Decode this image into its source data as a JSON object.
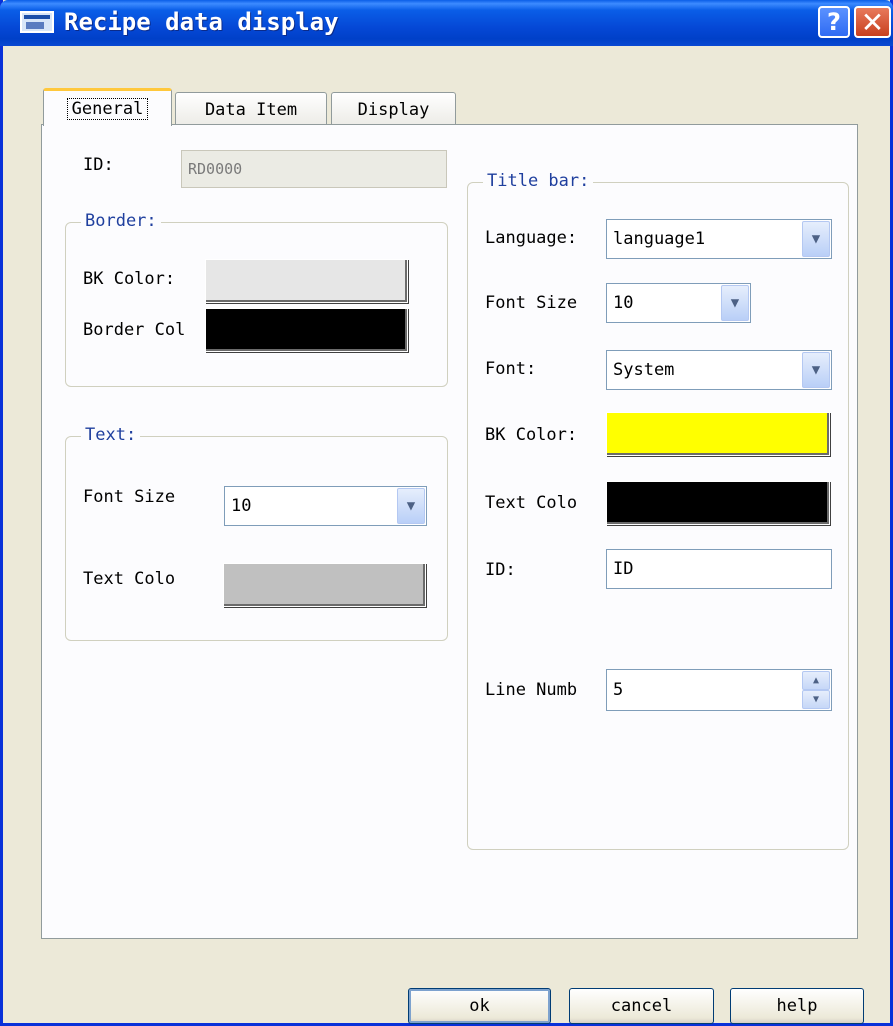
{
  "window": {
    "title": "Recipe data display"
  },
  "tabs": [
    "General",
    "Data Item",
    "Display"
  ],
  "general": {
    "id_label": "ID:",
    "id_value": "RD0000",
    "border": {
      "title": "Border:",
      "bk_color_label": "BK Color:",
      "bk_color": "#e6e6e6",
      "border_color_label": "Border Col",
      "border_color": "#000000"
    },
    "text": {
      "title": "Text:",
      "font_size_label": "Font Size",
      "font_size_value": "10",
      "text_color_label": "Text Colo",
      "text_color": "#c0c0c0"
    },
    "title_bar": {
      "title": "Title bar:",
      "language_label": "Language:",
      "language_value": "language1",
      "font_size_label": "Font Size",
      "font_size_value": "10",
      "font_label": "Font:",
      "font_value": "System",
      "bk_color_label": "BK Color:",
      "bk_color": "#ffff00",
      "text_color_label": "Text Colo",
      "text_color": "#000000",
      "id_label": "ID:",
      "id_value": "ID",
      "line_num_label": "Line Numb",
      "line_num_value": "5"
    }
  },
  "buttons": {
    "ok": "ok",
    "cancel": "cancel",
    "help": "help"
  },
  "icons": {
    "dropdown": "▼",
    "spin_up": "▲",
    "spin_down": "▼",
    "help": "?",
    "close": "✕"
  }
}
